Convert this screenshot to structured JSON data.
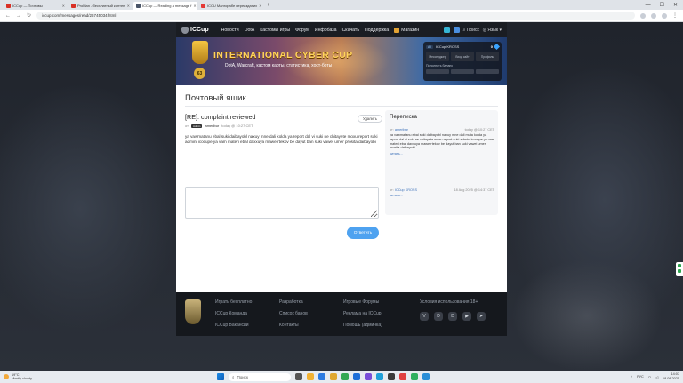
{
  "browser": {
    "tabs": [
      {
        "title": "ICCup — Почтовы",
        "active": false,
        "color": "#d93025"
      },
      {
        "title": "ProMan - бесплатный контен",
        "active": false,
        "color": "#d93025"
      },
      {
        "title": "ICCup — Reading a message f",
        "active": true,
        "color": "#4a5568"
      },
      {
        "title": "ICCU Мангорабе переизданих",
        "active": false,
        "color": "#e53935"
      }
    ],
    "new_tab": "+",
    "window_controls": [
      "—",
      "☐",
      "✕"
    ],
    "url": "iccup.com/messages/read/26745034.html"
  },
  "site": {
    "logo": "ICCup",
    "nav": [
      "Новости",
      "DotA",
      "Кастомы игры",
      "Форум",
      "Инфобаза",
      "Скачать",
      "Поддержка",
      "Магазин"
    ],
    "search": "Поиск",
    "language": "Язык"
  },
  "banner": {
    "title": "INTERNATIONAL CYBER CUP",
    "subtitle": "DotA, Warcraft, кастом карты, статистика, хост-боты",
    "badge": "63",
    "profile": {
      "level": "All",
      "username": "ICCup KROSS",
      "points": "0",
      "cells": [
        "Мессенджер",
        "Вход сайт",
        "Профиль"
      ],
      "stats_label": "Пополнить баланс"
    }
  },
  "page": {
    "title": "Почтовый ящик"
  },
  "message": {
    "subject": "[RE]: complaint reviewed",
    "delete_label": "Удалить",
    "from_prefix": "от",
    "from_badge": "Admin",
    "author": "ameribur",
    "time": "today @ 10:27 CET",
    "body": "ya vawmatanu ebal suki daibayobl naxuy mne dali kolda ya report dal vi suki ne chitayete moxu report suki admini icocupe ya vam materi ebal daxxuya mawerrtekov be dayut ban suki vawei umer prosita daibayobi",
    "reply_placeholder": "",
    "send_label": "Ответить"
  },
  "correspondence": {
    "title": "Переписка",
    "threads": [
      {
        "from_prefix": "от:",
        "from": "ameribur",
        "time": "today @ 10:27 CET",
        "text": "ya vawmatanu ebal suki daibayobl naxuy mne dali muta kolda ya report dal vi suki ne chitayete moxu report suki admini icocupe ya vam materi ebal daxxuya mawerrtekov be dayut ban suki vawei umer prosita daibayobi",
        "read_label": "читать..."
      },
      {
        "from_prefix": "от:",
        "from": "ICCup KROSS",
        "time": "18 Aug 2025 @ 14:37 CET",
        "text": "",
        "read_label": "читать..."
      }
    ]
  },
  "footer": {
    "col1": [
      "Играть бесплатно",
      "ICCup Команда",
      "ICCup Вакансии"
    ],
    "col2": [
      "Разработка",
      "Список банов",
      "Контакты"
    ],
    "col3": [
      "Игровые Форумы",
      "Реклама на ICCup",
      "Помощь (админка)"
    ],
    "terms": "Условия использования 18+",
    "socials": [
      "VK",
      "Discord",
      "Discord",
      "YouTube",
      "Telegram"
    ]
  },
  "taskbar": {
    "weather_temp": "19°C",
    "weather_desc": "Mostly cloudy",
    "search_placeholder": "Поиск",
    "lang": "РУС",
    "time": "14:07",
    "date": "18.08.2025"
  }
}
